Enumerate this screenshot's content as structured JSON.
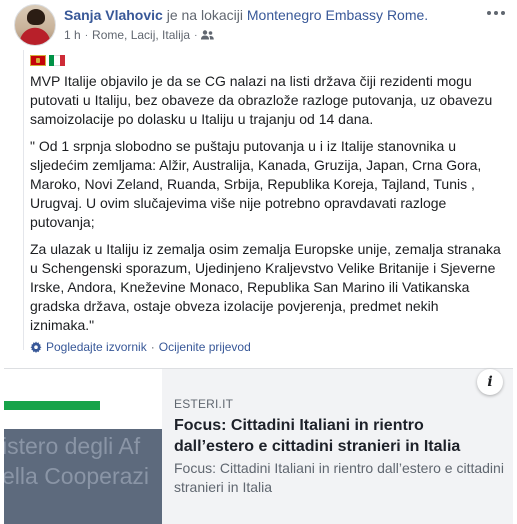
{
  "header": {
    "author": "Sanja Vlahovic",
    "action": "je na lokaciji",
    "place": "Montenegro Embassy Rome.",
    "time": "1 h",
    "separator": "·",
    "location": "Rome, Lacij, Italija",
    "privacy_icon": "friends-icon",
    "menu_icon": "more-options-icon"
  },
  "post": {
    "flags": [
      "flag-montenegro-icon",
      "flag-italy-icon"
    ],
    "paragraphs": [
      "MVP Italije objavilo je da se CG nalazi na listi država čiji rezidenti mogu putovati u Italiju, bez obaveze da obrazlože razloge putovanja, uz obavezu samoizolacije po dolasku u Italiju u trajanju od 14 dana.",
      "\" Od 1 srpnja slobodno se puštaju putovanja u i iz Italije stanovnika u sljedećim zemljama: Alžir, Australija, Kanada, Gruzija, Japan, Crna Gora, Maroko, Novi Zeland, Ruanda, Srbija, Republika Koreja, Tajland, Tunis , Urugvaj. U ovim slučajevima više nije potrebno opravdavati razloge putovanja;",
      "Za ulazak u Italiju iz zemalja osim zemalja Europske unije, zemalja stranaka u Schengenski sporazum, Ujedinjeno Kraljevstvo Velike Britanije i Sjeverne Irske, Andora, Kneževine Monaco, Republika San Marino ili Vatikanska gradska država, ostaje obveza izolacije povjerenja, predmet nekih iznimaka.\""
    ]
  },
  "translation": {
    "icon": "gear-icon",
    "see_original": "Pogledajte izvornik",
    "separator": "·",
    "rate": "Ocijenite prijevod"
  },
  "link_preview": {
    "image_text_line1": "istero degli Af",
    "image_text_line2": "ella Cooperazi",
    "domain": "ESTERI.IT",
    "title": "Focus: Cittadini Italiani in rientro dall’estero e cittadini stranieri in Italia",
    "description": "Focus: Cittadini Italiani in rientro dall’estero e cittadini stranieri in Italia",
    "info_label": "i"
  },
  "colors": {
    "link": "#385898",
    "secondary_text": "#616770",
    "preview_bg": "#f2f3f5",
    "image_green": "#17a34a"
  }
}
